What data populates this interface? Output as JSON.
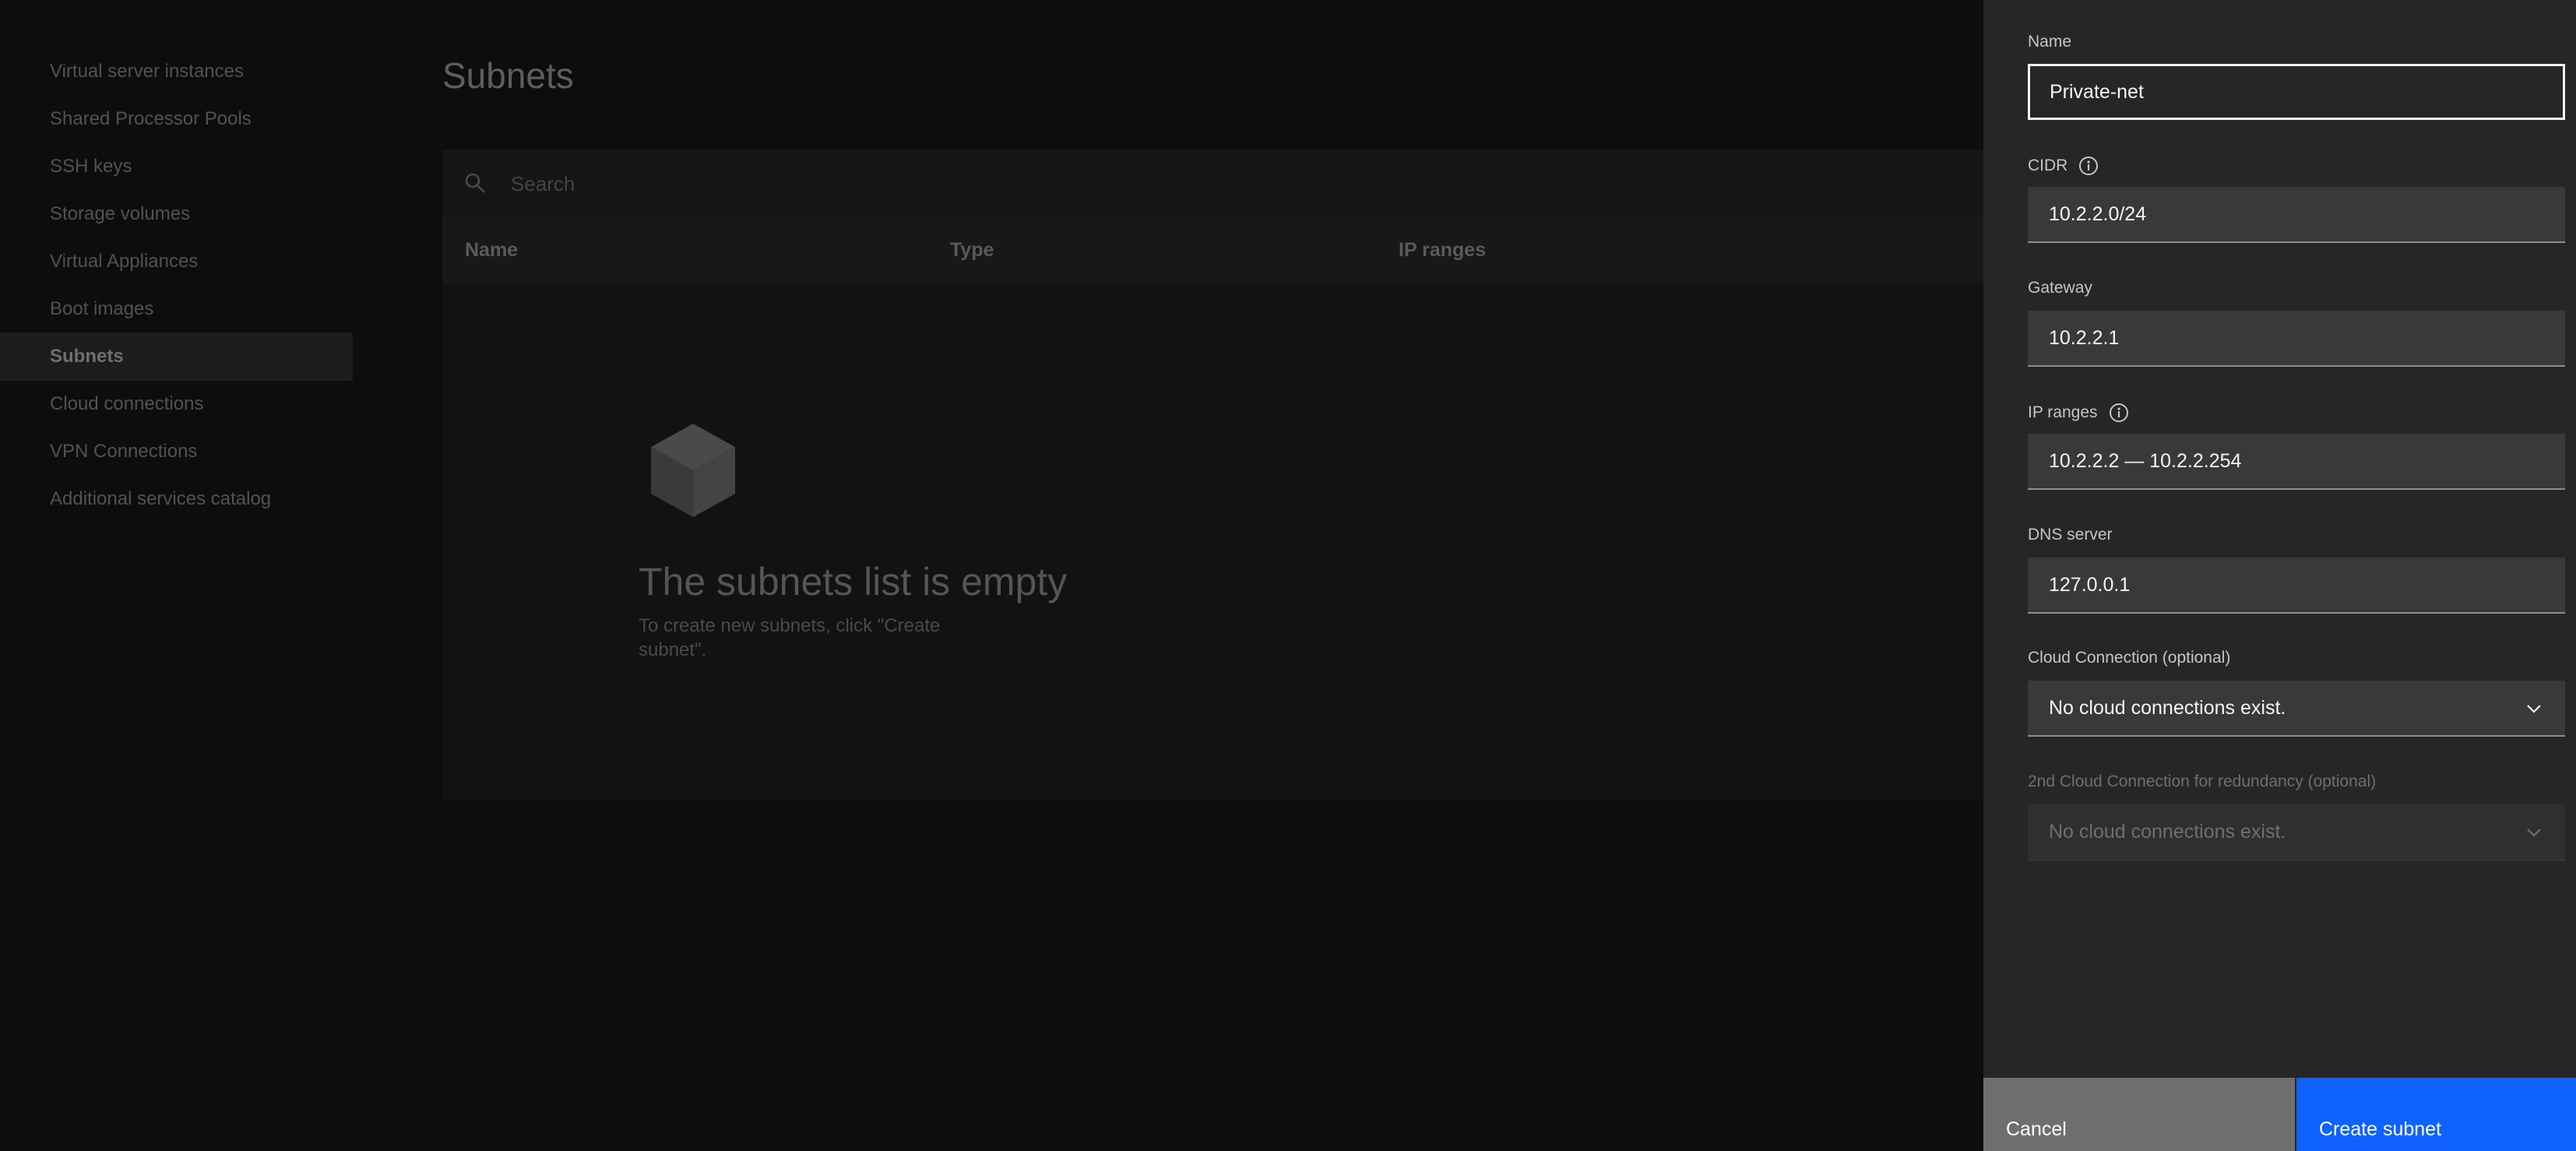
{
  "sidebar": {
    "items": [
      {
        "label": "Virtual server instances",
        "active": false
      },
      {
        "label": "Shared Processor Pools",
        "active": false
      },
      {
        "label": "SSH keys",
        "active": false
      },
      {
        "label": "Storage volumes",
        "active": false
      },
      {
        "label": "Virtual Appliances",
        "active": false
      },
      {
        "label": "Boot images",
        "active": false
      },
      {
        "label": "Subnets",
        "active": true
      },
      {
        "label": "Cloud connections",
        "active": false
      },
      {
        "label": "VPN Connections",
        "active": false
      },
      {
        "label": "Additional services catalog",
        "active": false
      }
    ]
  },
  "main": {
    "title": "Subnets",
    "search": {
      "placeholder": "Search"
    },
    "columns": [
      "Name",
      "Type",
      "IP ranges"
    ],
    "empty": {
      "icon": "cube-icon",
      "title": "The subnets list is empty",
      "description": "To create new subnets, click \"Create subnet\"."
    }
  },
  "panel": {
    "name": {
      "label": "Name",
      "value": "Private-net"
    },
    "cidr": {
      "label": "CIDR",
      "value": "10.2.2.0/24",
      "icon": "info-icon"
    },
    "gateway": {
      "label": "Gateway",
      "value": "10.2.2.1"
    },
    "ip_ranges": {
      "label": "IP ranges",
      "value": "10.2.2.2 — 10.2.2.254",
      "icon": "info-icon"
    },
    "dns": {
      "label": "DNS server",
      "value": "127.0.0.1"
    },
    "cloud_connection": {
      "label": "Cloud Connection (optional)",
      "value": "No cloud connections exist."
    },
    "cloud_connection_2": {
      "label": "2nd Cloud Connection for redundancy (optional)",
      "value": "No cloud connections exist.",
      "disabled": true
    },
    "cancel_label": "Cancel",
    "create_label": "Create subnet"
  },
  "colors": {
    "primary_button": "#0f62fe",
    "secondary_button": "#6f6f6f",
    "panel_bg": "#262626"
  }
}
